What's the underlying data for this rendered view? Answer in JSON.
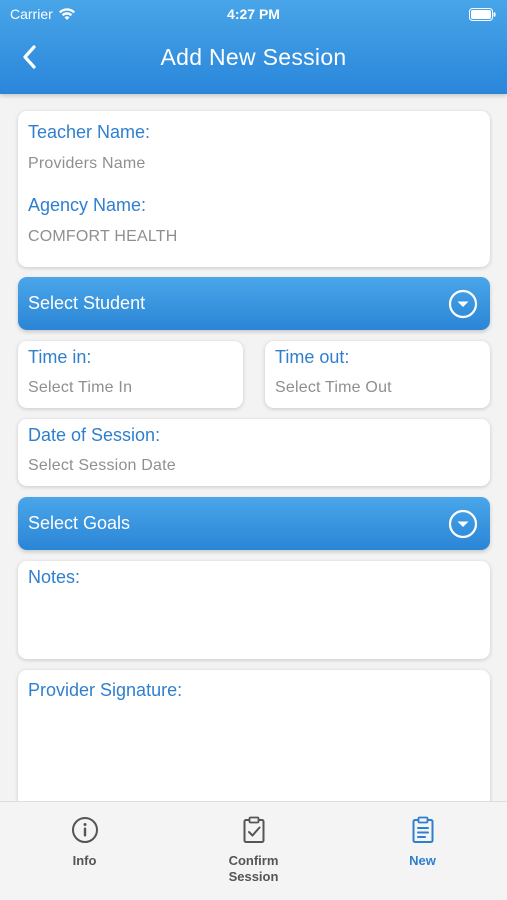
{
  "status_bar": {
    "carrier": "Carrier",
    "time": "4:27 PM"
  },
  "nav": {
    "title": "Add New Session",
    "back_icon": "chevron-left-icon"
  },
  "form": {
    "teacher_label": "Teacher Name:",
    "teacher_value": "Providers Name",
    "agency_label": "Agency Name:",
    "agency_value": "COMFORT HEALTH",
    "select_student_label": "Select Student",
    "time_in_label": "Time in:",
    "time_in_placeholder": "Select Time In",
    "time_out_label": "Time out:",
    "time_out_placeholder": "Select Time Out",
    "date_label": "Date of Session:",
    "date_placeholder": "Select Session Date",
    "select_goals_label": "Select Goals",
    "notes_label": "Notes:",
    "signature_label": "Provider Signature:"
  },
  "tabs": [
    {
      "label": "Info",
      "icon": "info-icon",
      "active": false
    },
    {
      "label": "Confirm\nSession",
      "icon": "clipboard-check-icon",
      "active": false
    },
    {
      "label": "New",
      "icon": "clipboard-list-icon",
      "active": true
    }
  ],
  "colors": {
    "brand_blue": "#2f7fcf",
    "header_gradient_top": "#48a5e8",
    "header_gradient_bottom": "#2a86da",
    "placeholder_gray": "#8f8f8f",
    "inactive_tab": "#555555"
  }
}
